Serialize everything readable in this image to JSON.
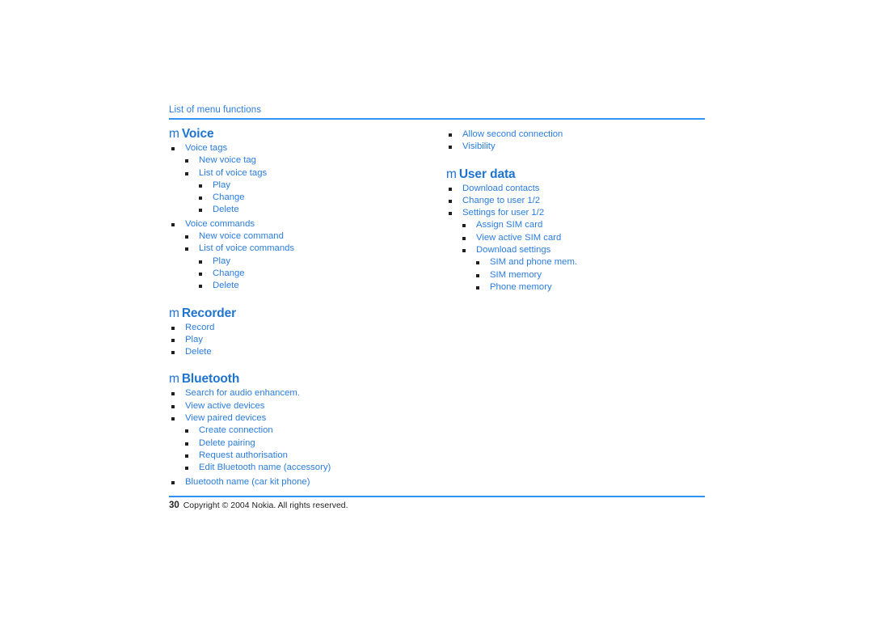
{
  "document": {
    "running_header": "List of menu functions",
    "heading_glyph": "m",
    "accent_color": "#2f92f5",
    "text_color": "#2a7ce0",
    "bullet_color": "#231f20"
  },
  "footer": {
    "page_number": "30",
    "copyright": "Copyright © 2004 Nokia. All rights reserved."
  },
  "left_column": {
    "sections": [
      {
        "title": "Voice",
        "items": [
          {
            "label": "Voice tags",
            "level": 1
          },
          {
            "label": "New voice tag",
            "level": 2
          },
          {
            "label": "List of voice tags",
            "level": 2
          },
          {
            "label": "Play",
            "level": 3
          },
          {
            "label": "Change",
            "level": 3
          },
          {
            "label": "Delete",
            "level": 3
          },
          {
            "label": "Voice commands",
            "level": 1
          },
          {
            "label": "New voice command",
            "level": 2
          },
          {
            "label": "List of voice commands",
            "level": 2
          },
          {
            "label": "Play",
            "level": 3
          },
          {
            "label": "Change",
            "level": 3
          },
          {
            "label": "Delete",
            "level": 3
          }
        ]
      },
      {
        "title": "Recorder",
        "items": [
          {
            "label": "Record",
            "level": 1
          },
          {
            "label": "Play",
            "level": 1
          },
          {
            "label": "Delete",
            "level": 1
          }
        ]
      },
      {
        "title": "Bluetooth",
        "items": [
          {
            "label": "Search for audio enhancem.",
            "level": 1
          },
          {
            "label": "View active devices",
            "level": 1
          },
          {
            "label": "View paired devices",
            "level": 1
          },
          {
            "label": "Create connection",
            "level": 2
          },
          {
            "label": "Delete pairing",
            "level": 2
          },
          {
            "label": "Request authorisation",
            "level": 2
          },
          {
            "label": "Edit Bluetooth name (accessory)",
            "level": 2
          },
          {
            "label": "Bluetooth name (car kit phone)",
            "level": 1
          }
        ]
      }
    ]
  },
  "right_column": {
    "continued_items": [
      {
        "label": "Allow second connection",
        "level": 1
      },
      {
        "label": "Visibility",
        "level": 1
      }
    ],
    "sections": [
      {
        "title": "User data",
        "items": [
          {
            "label": "Download contacts",
            "level": 1
          },
          {
            "label": "Change to user 1/2",
            "level": 1
          },
          {
            "label": "Settings for user 1/2",
            "level": 1
          },
          {
            "label": "Assign SIM card",
            "level": 2
          },
          {
            "label": "View active SIM card",
            "level": 2
          },
          {
            "label": "Download settings",
            "level": 2
          },
          {
            "label": "SIM and phone mem.",
            "level": 3
          },
          {
            "label": "SIM memory",
            "level": 3
          },
          {
            "label": "Phone memory",
            "level": 3
          }
        ]
      }
    ]
  }
}
